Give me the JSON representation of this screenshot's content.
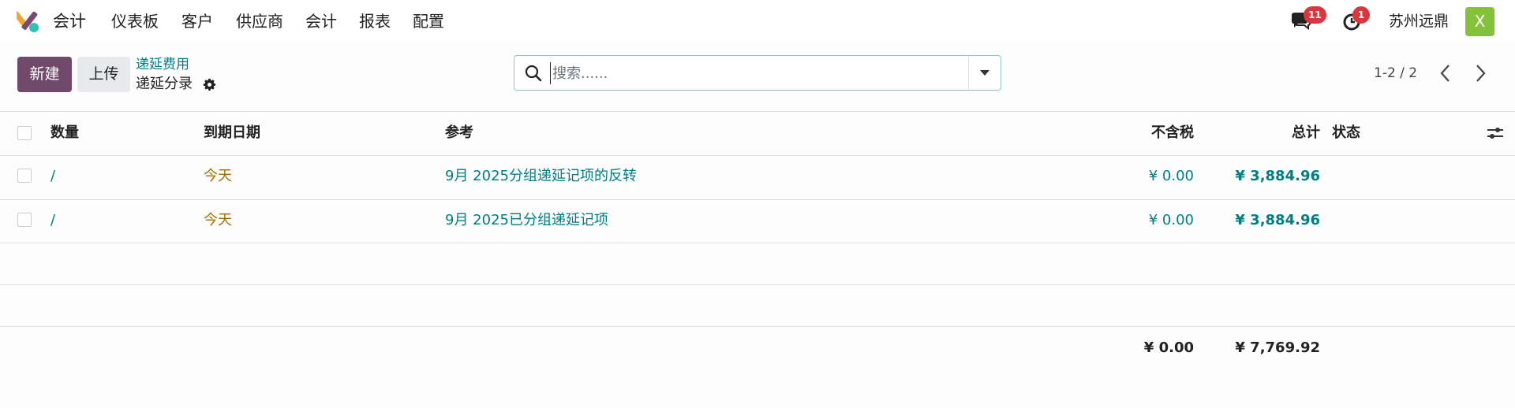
{
  "navbar": {
    "app_name": "会计",
    "menu": [
      "仪表板",
      "客户",
      "供应商",
      "会计",
      "报表",
      "配置"
    ],
    "messages_count": "11",
    "activities_count": "1",
    "company": "苏州远鼎",
    "avatar_letter": "X"
  },
  "control_panel": {
    "new_label": "新建",
    "upload_label": "上传",
    "breadcrumb_parent": "递延费用",
    "breadcrumb_current": "递延分录",
    "search_placeholder": "搜索......",
    "pager": "1-2 / 2"
  },
  "table": {
    "headers": {
      "quantity": "数量",
      "due_date": "到期日期",
      "reference": "参考",
      "untaxed": "不含税",
      "total": "总计",
      "status": "状态"
    },
    "rows": [
      {
        "number": "/",
        "due_date": "今天",
        "reference": "9月 2025分组递延记项的反转",
        "untaxed": "¥ 0.00",
        "total": "¥ 3,884.96",
        "status": ""
      },
      {
        "number": "/",
        "due_date": "今天",
        "reference": "9月 2025已分组递延记项",
        "untaxed": "¥ 0.00",
        "total": "¥ 3,884.96",
        "status": ""
      }
    ],
    "footer": {
      "untaxed": "¥ 0.00",
      "total": "¥ 7,769.92"
    }
  },
  "colors": {
    "primary": "#71496a",
    "link": "#017e84",
    "date_warning": "#a16f00",
    "badge": "#d9363e",
    "avatar": "#84c23b"
  },
  "icons": [
    "app-logo-icon",
    "chat-icon",
    "clock-icon",
    "gear-icon",
    "search-icon",
    "caret-down-icon",
    "chevron-left-icon",
    "chevron-right-icon",
    "settings-sliders-icon"
  ]
}
